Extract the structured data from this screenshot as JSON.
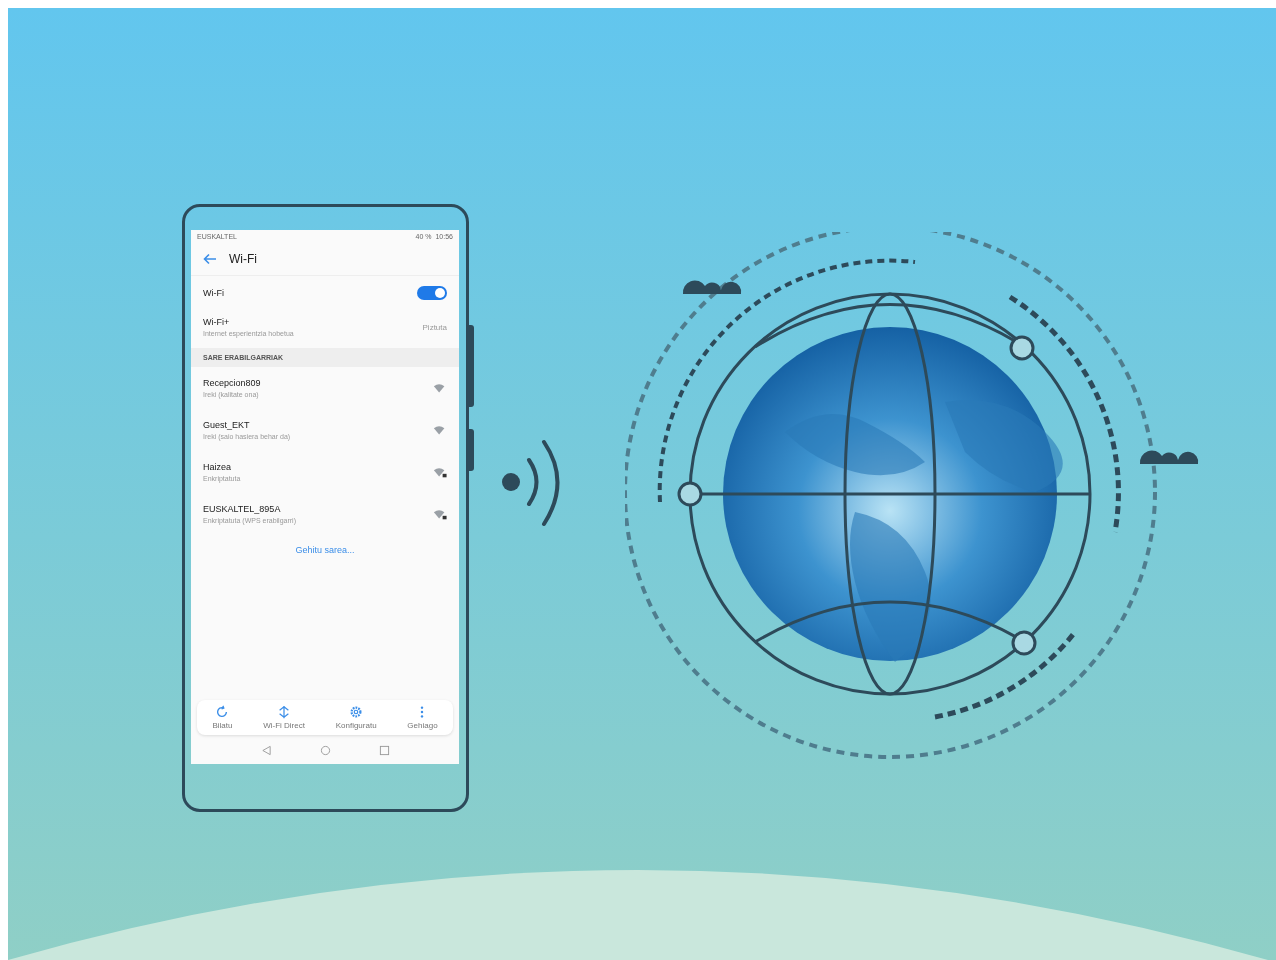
{
  "status_bar": {
    "carrier": "EUSKALTEL",
    "battery": "40 %",
    "time": "10:56"
  },
  "header": {
    "title": "Wi-Fi"
  },
  "wifi_toggle": {
    "label": "Wi-Fi",
    "on": true
  },
  "wifi_plus": {
    "label": "Wi-Fi+",
    "description": "Internet esperientzia hobetua",
    "value": "Piztuta"
  },
  "section_title": "SARE ERABILGARRIAK",
  "networks": [
    {
      "name": "Recepcion809",
      "status": "Ireki (kalitate ona)",
      "locked": false
    },
    {
      "name": "Guest_EKT",
      "status": "Ireki (saio hasiera behar da)",
      "locked": false
    },
    {
      "name": "Haizea",
      "status": "Enkriptatuta",
      "locked": true
    },
    {
      "name": "EUSKALTEL_895A",
      "status": "Enkriptatuta (WPS erabilgarri)",
      "locked": true
    }
  ],
  "add_network": "Gehitu sarea...",
  "toolbar": [
    {
      "kind": "refresh",
      "label": "Bilatu"
    },
    {
      "kind": "direct",
      "label": "Wi-Fi Direct"
    },
    {
      "kind": "gear",
      "label": "Konfiguratu"
    },
    {
      "kind": "more",
      "label": "Gehiago"
    }
  ]
}
